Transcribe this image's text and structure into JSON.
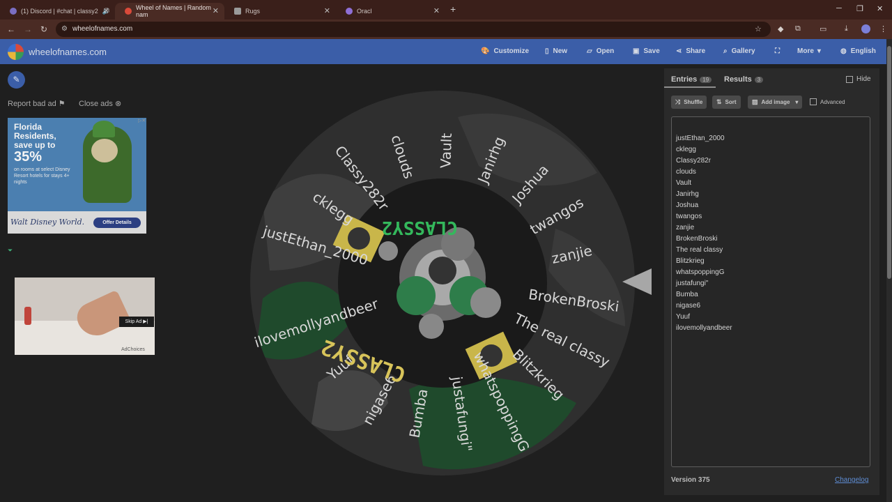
{
  "browser": {
    "tabs": [
      {
        "title": "(1) Discord | #chat | classy2",
        "favicon_color": "#7a6ec2"
      },
      {
        "title": "Wheel of Names | Random nam",
        "favicon_color": "#d94a3a"
      },
      {
        "title": "Rugs",
        "favicon_color": "#9a9a9a"
      },
      {
        "title": "Oracl",
        "favicon_color": "#8f6fd6"
      }
    ],
    "url": "wheelofnames.com"
  },
  "app": {
    "brand": "wheelofnames.com",
    "menu": {
      "customize": "Customize",
      "new": "New",
      "open": "Open",
      "save": "Save",
      "share": "Share",
      "gallery": "Gallery",
      "more": "More",
      "language": "English"
    }
  },
  "left": {
    "report_bad_ad": "Report bad ad",
    "close_ads": "Close ads",
    "ad1": {
      "headline": "Florida Residents, save up to",
      "percent": "35%",
      "fine_print": "on rooms at select Disney Resort hotels for stays 4+ nights",
      "brand": "Walt Disney World.",
      "cta": "Offer Details"
    },
    "ad2": {
      "skip": "Skip Ad ▶|",
      "adchoices": "AdChoices"
    }
  },
  "wheel": {
    "entries": [
      "justEthan_2000",
      "cklegg",
      "Classy282r",
      "clouds",
      "Vault",
      "Janirhg",
      "Joshua",
      "twangos",
      "zanjie",
      "BrokenBroski",
      "The real classy",
      "Blitzkrieg",
      "whatspoppingG",
      "justafungi\"",
      "Bumba",
      "nigase6",
      "Yuuf",
      "ilovemollyandbeer"
    ],
    "center_text": "CLASSY2"
  },
  "panel": {
    "entries_tab": "Entries",
    "entries_count": "19",
    "results_tab": "Results",
    "results_count": "3",
    "hide": "Hide",
    "shuffle": "Shuffle",
    "sort": "Sort",
    "add_image": "Add image",
    "advanced": "Advanced",
    "entries": [
      "justEthan_2000",
      "cklegg",
      "Classy282r",
      "clouds",
      "Vault",
      "Janirhg",
      "Joshua",
      "twangos",
      "zanjie",
      "BrokenBroski",
      "The real classy",
      "Blitzkrieg",
      "whatspoppingG",
      "justafungi\"",
      "Bumba",
      "nigase6",
      "Yuuf",
      "ilovemollyandbeer"
    ],
    "version": "Version 375",
    "changelog": "Changelog"
  }
}
